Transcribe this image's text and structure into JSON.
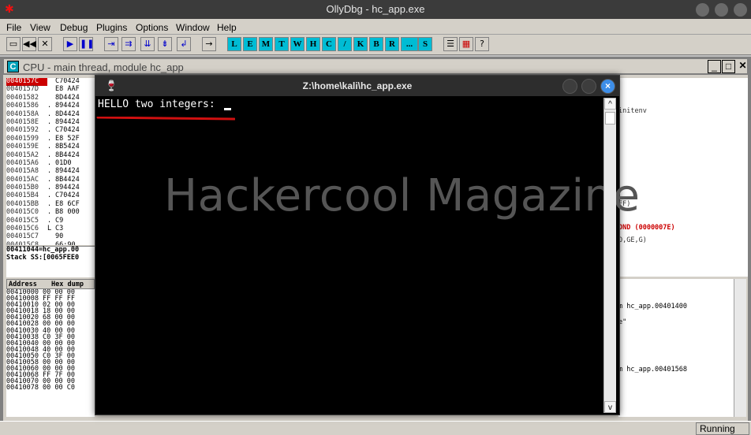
{
  "app": {
    "title": "OllyDbg - hc_app.exe",
    "status": "Running"
  },
  "menu": [
    "File",
    "View",
    "Debug",
    "Plugins",
    "Options",
    "Window",
    "Help"
  ],
  "toolbar_letters": [
    "L",
    "E",
    "M",
    "T",
    "W",
    "H",
    "C",
    "/",
    "K",
    "B",
    "R",
    "...",
    "S"
  ],
  "cpu": {
    "title": "CPU - main thread, module hc_app"
  },
  "disasm": {
    "rows": [
      {
        "addr": "0040157C",
        "mk": " ",
        "code": "C70424"
      },
      {
        "addr": "0040157D",
        "mk": " ",
        "code": "E8 AAF"
      },
      {
        "addr": "00401582",
        "mk": " ",
        "code": "8D4424"
      },
      {
        "addr": "00401586",
        "mk": ".",
        "code": "894424"
      },
      {
        "addr": "0040158A",
        "mk": ".",
        "code": "8D4424"
      },
      {
        "addr": "0040158E",
        "mk": ".",
        "code": "894424"
      },
      {
        "addr": "00401592",
        "mk": ".",
        "code": "C70424"
      },
      {
        "addr": "00401599",
        "mk": ".",
        "code": "E8 52F"
      },
      {
        "addr": "0040159E",
        "mk": ".",
        "code": "8B5424"
      },
      {
        "addr": "004015A2",
        "mk": ".",
        "code": "8B4424"
      },
      {
        "addr": "004015A6",
        "mk": ".",
        "code": "01D0"
      },
      {
        "addr": "004015A8",
        "mk": ".",
        "code": "894424"
      },
      {
        "addr": "004015AC",
        "mk": ".",
        "code": "8B4424"
      },
      {
        "addr": "004015B0",
        "mk": ".",
        "code": "894424"
      },
      {
        "addr": "004015B4",
        "mk": ".",
        "code": "C70424"
      },
      {
        "addr": "004015BB",
        "mk": ".",
        "code": "E8 6CF"
      },
      {
        "addr": "004015C0",
        "mk": ".",
        "code": "B8 000"
      },
      {
        "addr": "004015C5",
        "mk": ".",
        "code": "C9"
      },
      {
        "addr": "004015C6",
        "mk": "L",
        "code": "C3"
      },
      {
        "addr": "004015C7",
        "mk": " ",
        "code": "90"
      },
      {
        "addr": "004015C8",
        "mk": ".",
        "code": "66:90"
      }
    ]
  },
  "info": {
    "line1": "00411044=hc_app.00",
    "line2": "Stack SS:[0065FEE0"
  },
  "hex": {
    "header_addr": "Address",
    "header_dump": "Hex dump",
    "rows": [
      "00410000 00 00 00",
      "00410008 FF FF FF",
      "00410010 02 00 00",
      "00410018 18 00 00",
      "00410020 68 00 00",
      "00410028 00 00 00",
      "00410030 40 00 00",
      "00410038 C0 3F 00",
      "00410040 00 00 00",
      "00410048 40 00 00",
      "00410050 C0 3F 00",
      "00410058 00 00 00",
      "00410060 00 00 00",
      "00410068 FF 7F 00",
      "00410070 00 00 00",
      "00410078 00 00 C0"
    ]
  },
  "right": {
    "arrows": [
      "<",
      "<",
      "<",
      "<"
    ],
    "initenv": "initenv",
    "ff": "FF)",
    "cond": "OND (0000007E)",
    "flags": "O,GE,G)"
  },
  "stack": {
    "l1": "m hc_app.00401400",
    "l2": "e\"",
    "l3": "m hc_app.00401568"
  },
  "console": {
    "title": "Z:\\home\\kali\\hc_app.exe",
    "text": "HELLO two integers: ",
    "close": "×",
    "watermark": "Hackercool Magazine",
    "scroll_up": "^",
    "scroll_down": "v"
  }
}
